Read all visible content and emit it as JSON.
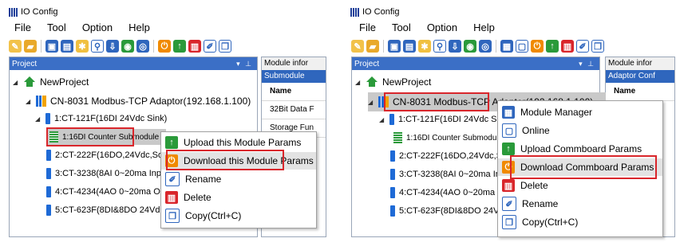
{
  "app": {
    "title": "IO Config"
  },
  "menubar": [
    "File",
    "Tool",
    "Option",
    "Help"
  ],
  "colors": {
    "panel_header": "#3b6fc6",
    "highlight_box": "#d9262b",
    "selection": "#c9c9c9"
  },
  "left": {
    "panel_title": "Project",
    "panel_controls": "▾ ⊥",
    "side_panel": {
      "title": "Module infor",
      "sub_header": "Submodule",
      "rows": [
        "Name",
        "32Bit Data F",
        "Storage Fun"
      ]
    },
    "tree": {
      "root": "NewProject",
      "adaptor": "CN-8031 Modbus-TCP Adaptor(192.168.1.100)",
      "modules": [
        "1:CT-121F(16DI 24Vdc Sink)",
        "1:16DI Counter Submodule",
        "2:CT-222F(16DO,24Vdc,Sou",
        "3:CT-3238(8AI 0~20ma Inpu",
        "4:CT-4234(4AO 0~20ma Ou",
        "5:CT-623F(8DI&8DO 24Vdc"
      ]
    },
    "context_menu": [
      {
        "label": "Upload this Module Params",
        "icon": "upload-icon"
      },
      {
        "label": "Download this Module Params",
        "icon": "download-icon"
      },
      {
        "label": "Rename",
        "icon": "rename-icon"
      },
      {
        "label": "Delete",
        "icon": "delete-icon"
      },
      {
        "label": "Copy(Ctrl+C)",
        "icon": "copy-icon"
      }
    ]
  },
  "right": {
    "panel_title": "Project",
    "panel_controls": "▾ ⊥",
    "side_panel": {
      "title": "Module infor",
      "sub_header": "Adaptor Conf",
      "rows": [
        "Name"
      ]
    },
    "tree": {
      "root": "NewProject",
      "adaptor": "CN-8031 Modbus-TCP Adaptor(192.168.1.100)",
      "modules": [
        "1:CT-121F(16DI 24Vdc Sink",
        "1:16DI Counter Submodule",
        "2:CT-222F(16DO,24Vdc,Sou",
        "3:CT-3238(8AI 0~20ma Inpu",
        "4:CT-4234(4AO 0~20ma Ou",
        "5:CT-623F(8DI&8DO 24Vdc"
      ]
    },
    "context_menu": [
      {
        "label": "Module Manager",
        "icon": "module-manager-icon"
      },
      {
        "label": "Online",
        "icon": "online-icon"
      },
      {
        "label": "Upload Commboard Params",
        "icon": "upload-icon"
      },
      {
        "label": "Download Commboard Params",
        "icon": "download-icon"
      },
      {
        "label": "Delete",
        "icon": "delete-icon"
      },
      {
        "label": "Rename",
        "icon": "rename-icon"
      },
      {
        "label": "Copy(Ctrl+C)",
        "icon": "copy-icon"
      }
    ]
  }
}
